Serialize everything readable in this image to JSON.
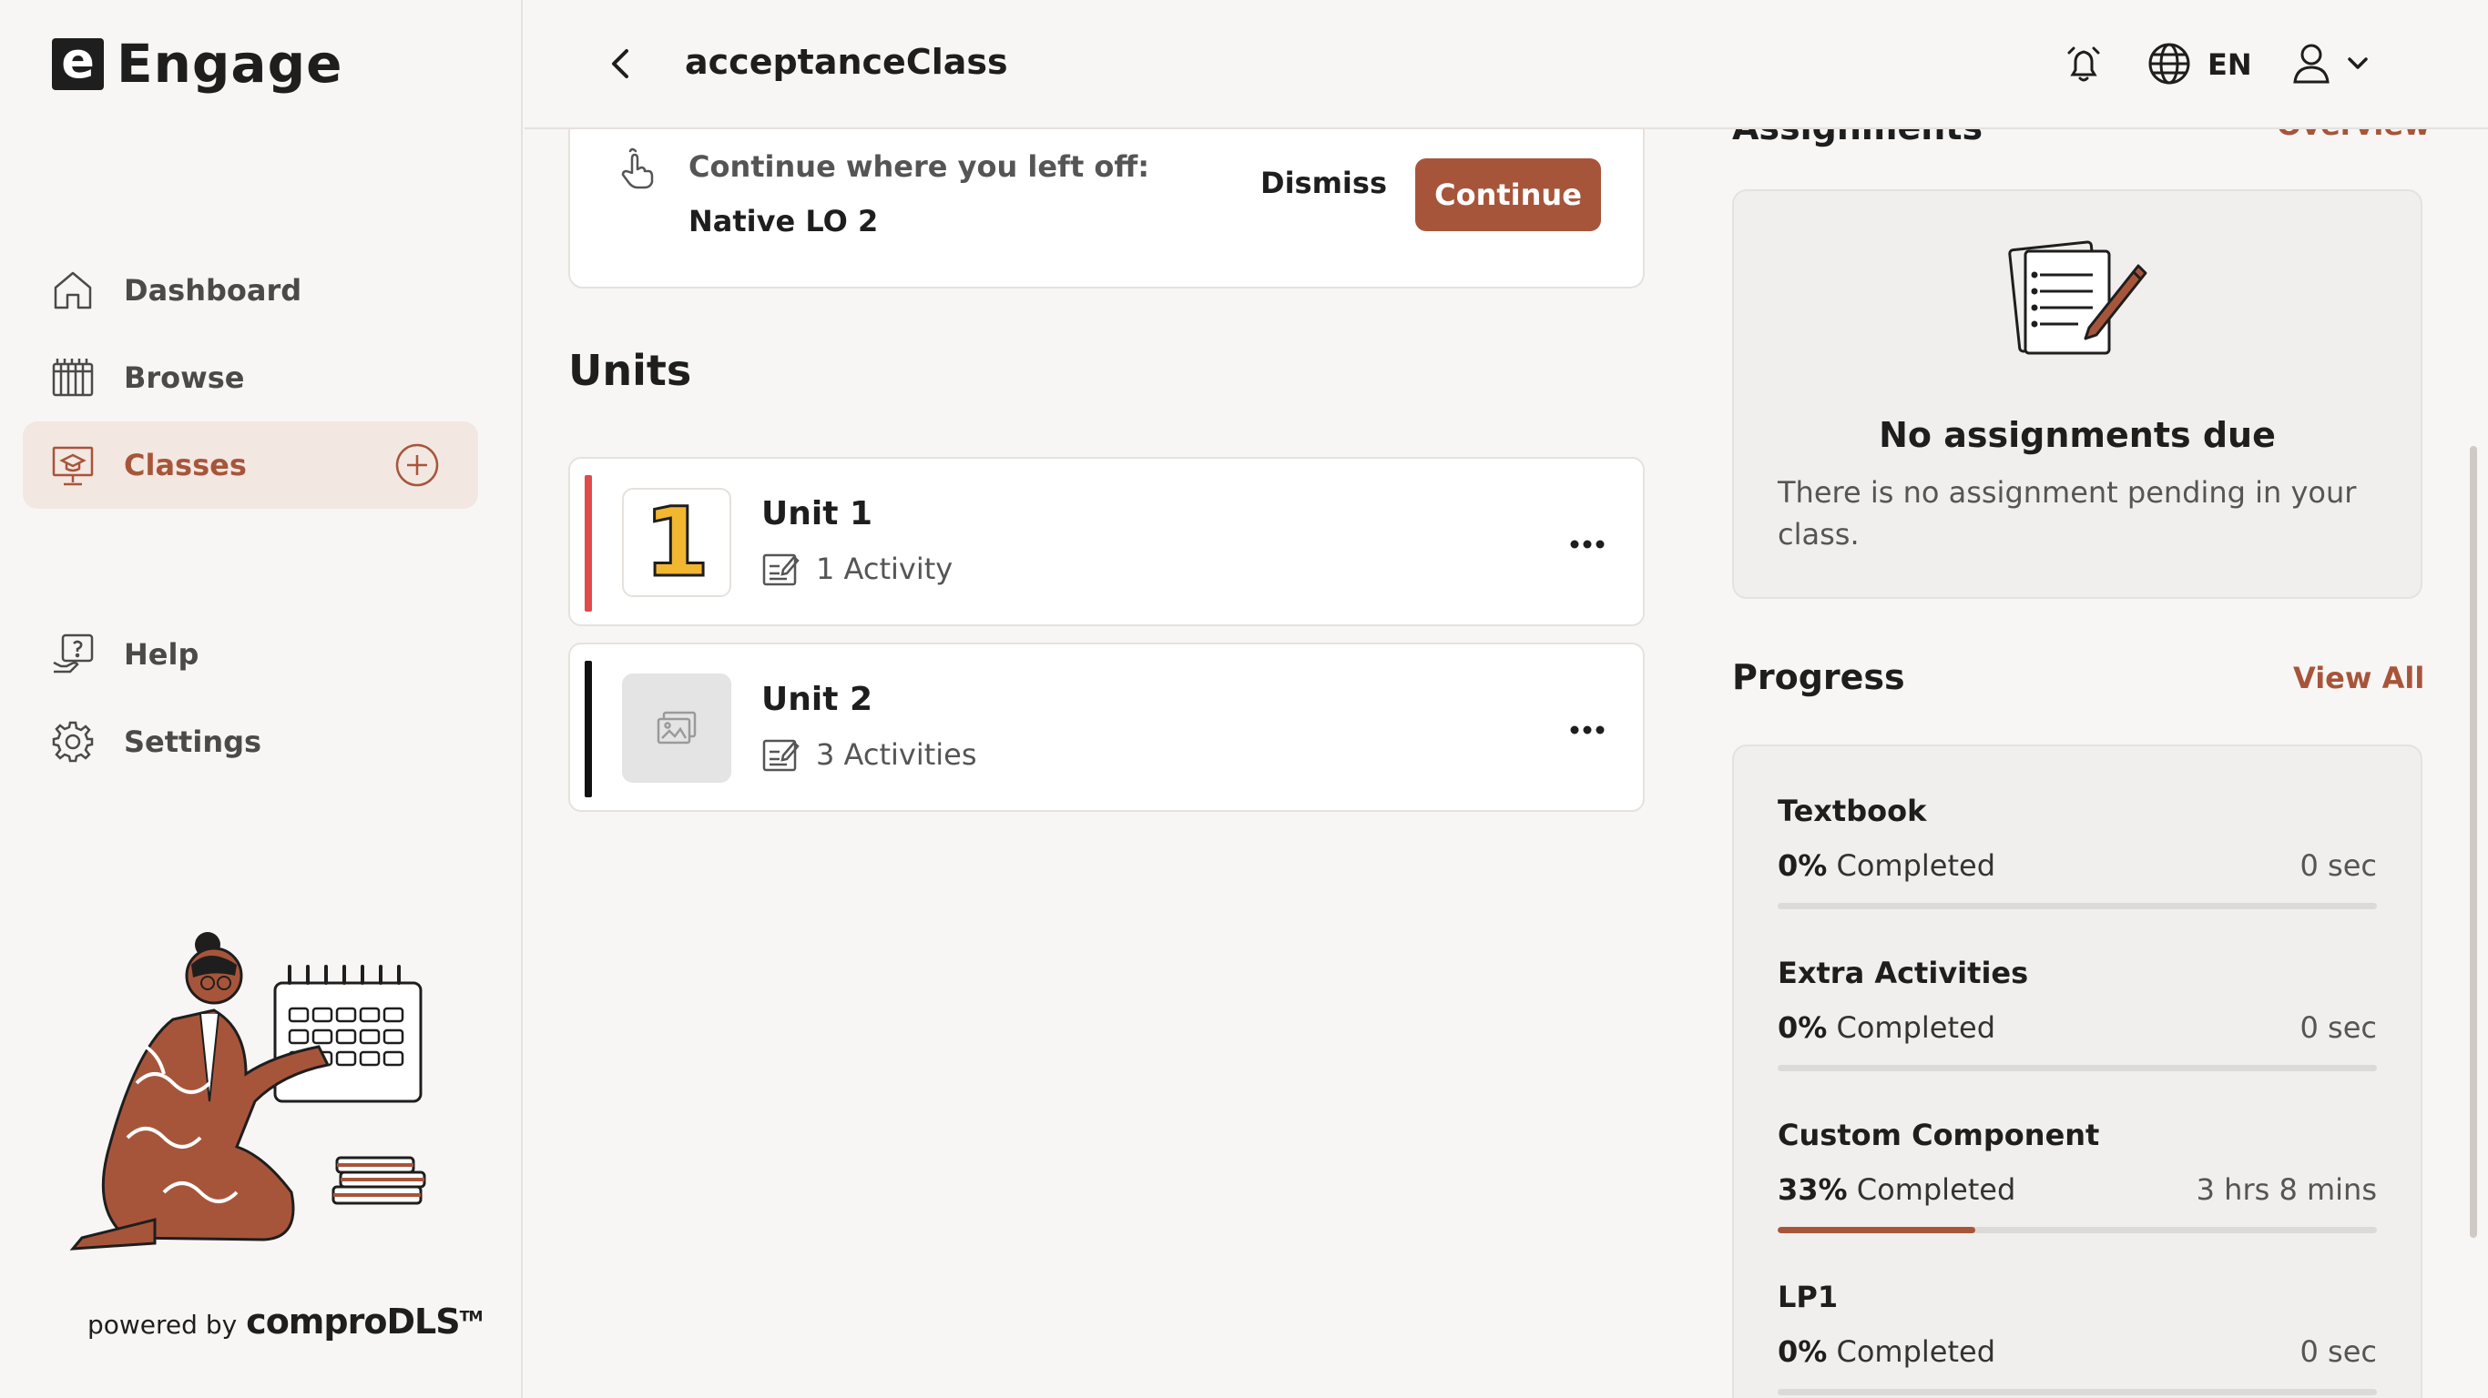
{
  "app": {
    "logo_letter": "e",
    "logo_text": "Engage"
  },
  "sidebar": {
    "items": [
      {
        "label": "Dashboard",
        "icon": "home-icon"
      },
      {
        "label": "Browse",
        "icon": "browse-icon"
      },
      {
        "label": "Classes",
        "icon": "classes-icon",
        "active": true
      },
      {
        "label": "Help",
        "icon": "help-icon"
      },
      {
        "label": "Settings",
        "icon": "gear-icon"
      }
    ],
    "powered_prefix": "powered by",
    "powered_brand": "comproDLS",
    "powered_tm": "TM"
  },
  "header": {
    "title": "acceptanceClass",
    "language": "EN"
  },
  "resume": {
    "prompt": "Continue where you left off:",
    "item": "Native LO 2",
    "dismiss_label": "Dismiss",
    "continue_label": "Continue"
  },
  "units": {
    "title": "Units",
    "items": [
      {
        "name": "Unit 1",
        "activities": "1 Activity",
        "thumb_text": "1",
        "bar_color": "#e04a4a"
      },
      {
        "name": "Unit 2",
        "activities": "3 Activities",
        "thumb_text": "",
        "bar_color": "#111111"
      }
    ]
  },
  "assignments": {
    "title_partial": "Assignments",
    "link_partial": "Overview",
    "empty_heading": "No assignments due",
    "empty_text": "There is no assignment pending in your class."
  },
  "progress": {
    "title": "Progress",
    "view_all": "View All",
    "items": [
      {
        "name": "Textbook",
        "percent": "0%",
        "completed_label": "Completed",
        "time": "0 sec",
        "fraction": 0
      },
      {
        "name": "Extra Activities",
        "percent": "0%",
        "completed_label": "Completed",
        "time": "0 sec",
        "fraction": 0
      },
      {
        "name": "Custom Component",
        "percent": "33%",
        "completed_label": "Completed",
        "time": "3 hrs 8 mins",
        "fraction": 0.33
      },
      {
        "name": "LP1",
        "percent": "0%",
        "completed_label": "Completed",
        "time": "0 sec",
        "fraction": 0
      }
    ]
  },
  "colors": {
    "accent": "#a7553a",
    "active_bg": "#f3e7e2",
    "background": "#f8f6f4"
  }
}
